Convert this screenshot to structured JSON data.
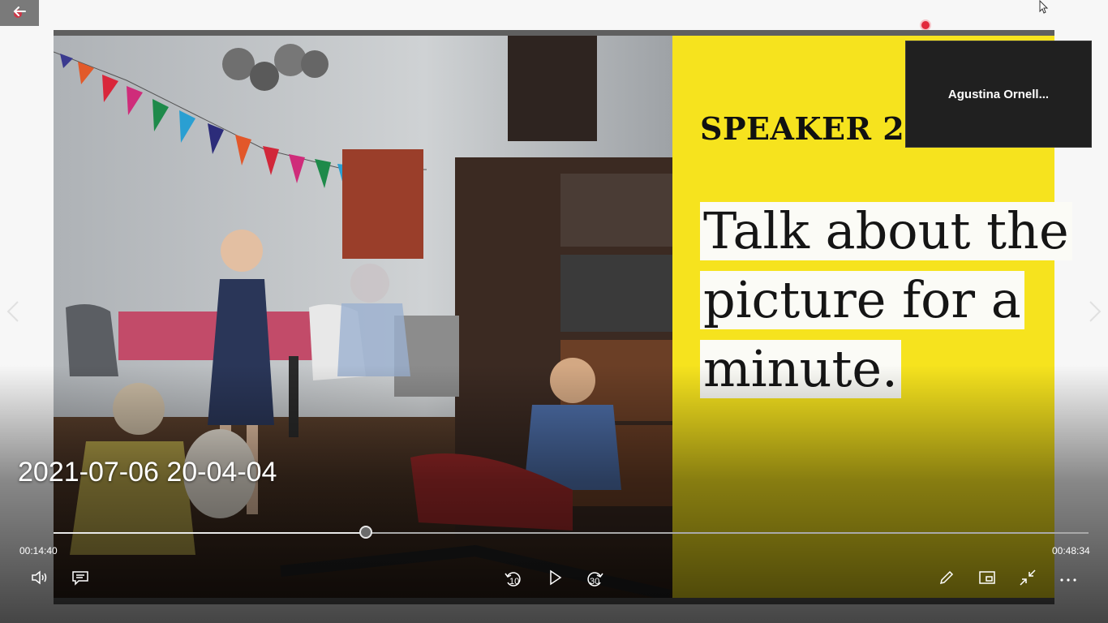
{
  "window": {
    "back_icon": "back-arrow-icon",
    "recording_indicator_color": "#e2283c"
  },
  "slide": {
    "background_color": "#f6e31e",
    "speaker_title": "SPEAKER 2",
    "prompt_lines": [
      "Talk about the",
      "picture for a",
      "minute."
    ]
  },
  "participant": {
    "name": "Agustina  Ornell..."
  },
  "player": {
    "video_title": "2021-07-06 20-04-04",
    "current_time": "00:14:40",
    "total_time": "00:48:34",
    "progress_fraction": 0.302,
    "skip_back_seconds": "10",
    "skip_forward_seconds": "30",
    "icons": {
      "volume": "volume-icon",
      "captions": "captions-icon",
      "skip_back": "skip-back-10-icon",
      "play": "play-icon",
      "skip_forward": "skip-forward-30-icon",
      "draw": "pen-icon",
      "mini_view": "mini-view-icon",
      "exit_fullscreen": "exit-fullscreen-icon",
      "more": "more-options-icon",
      "previous": "chevron-left-icon",
      "next": "chevron-right-icon"
    }
  }
}
